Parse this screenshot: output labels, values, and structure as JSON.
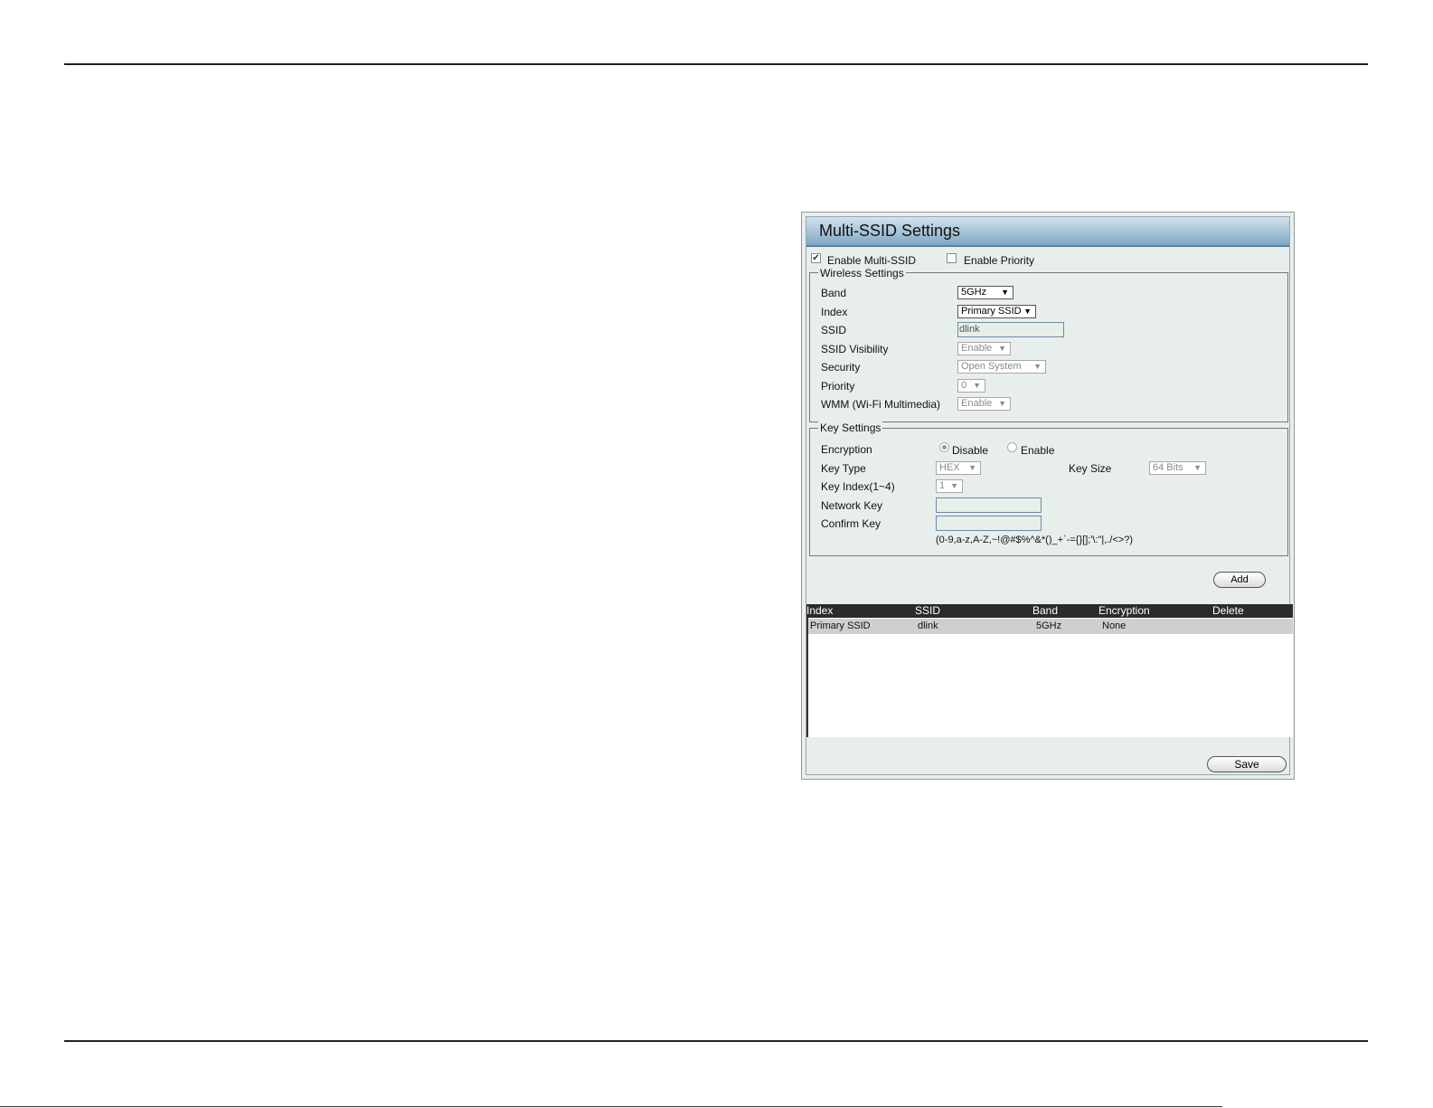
{
  "panel": {
    "title": "Multi-SSID Settings",
    "enable_multi_ssid": {
      "label": "Enable Multi-SSID",
      "checked": true
    },
    "enable_priority": {
      "label": "Enable Priority",
      "checked": false
    },
    "wireless_settings": {
      "legend": "Wireless Settings",
      "band": {
        "label": "Band",
        "value": "5GHz"
      },
      "index": {
        "label": "Index",
        "value": "Primary SSID"
      },
      "ssid": {
        "label": "SSID",
        "value": "dlink"
      },
      "ssid_visibility": {
        "label": "SSID Visibility",
        "value": "Enable"
      },
      "security": {
        "label": "Security",
        "value": "Open System"
      },
      "priority": {
        "label": "Priority",
        "value": "0"
      },
      "wmm": {
        "label": "WMM (Wi-Fi Multimedia)",
        "value": "Enable"
      }
    },
    "key_settings": {
      "legend": "Key Settings",
      "encryption": {
        "label": "Encryption",
        "disable_label": "Disable",
        "enable_label": "Enable",
        "selected": "Disable"
      },
      "key_type": {
        "label": "Key Type",
        "value": "HEX"
      },
      "key_size": {
        "label": "Key Size",
        "value": "64 Bits"
      },
      "key_index": {
        "label": "Key Index(1~4)",
        "value": "1"
      },
      "network_key": {
        "label": "Network Key",
        "value": ""
      },
      "confirm_key": {
        "label": "Confirm Key",
        "value": ""
      },
      "allowed_chars": "(0-9,a-z,A-Z,~!@#$%^&*()_+`-={}[];'\\:\"|,./<>?)"
    },
    "add_button": "Add",
    "table": {
      "headers": [
        "Index",
        "SSID",
        "Band",
        "Encryption",
        "Delete"
      ],
      "rows": [
        {
          "index": "Primary SSID",
          "ssid": "dlink",
          "band": "5GHz",
          "encryption": "None",
          "delete": ""
        }
      ]
    },
    "save_button": "Save"
  },
  "icons": {
    "checkbox_check": "✔",
    "dropdown_arrow": "▼"
  },
  "colors": {
    "title_bar": "#a6c3d7",
    "panel_bg": "#e8eeec",
    "table_header": "#2b2b2b",
    "row_bg": "#cfcfcf"
  }
}
